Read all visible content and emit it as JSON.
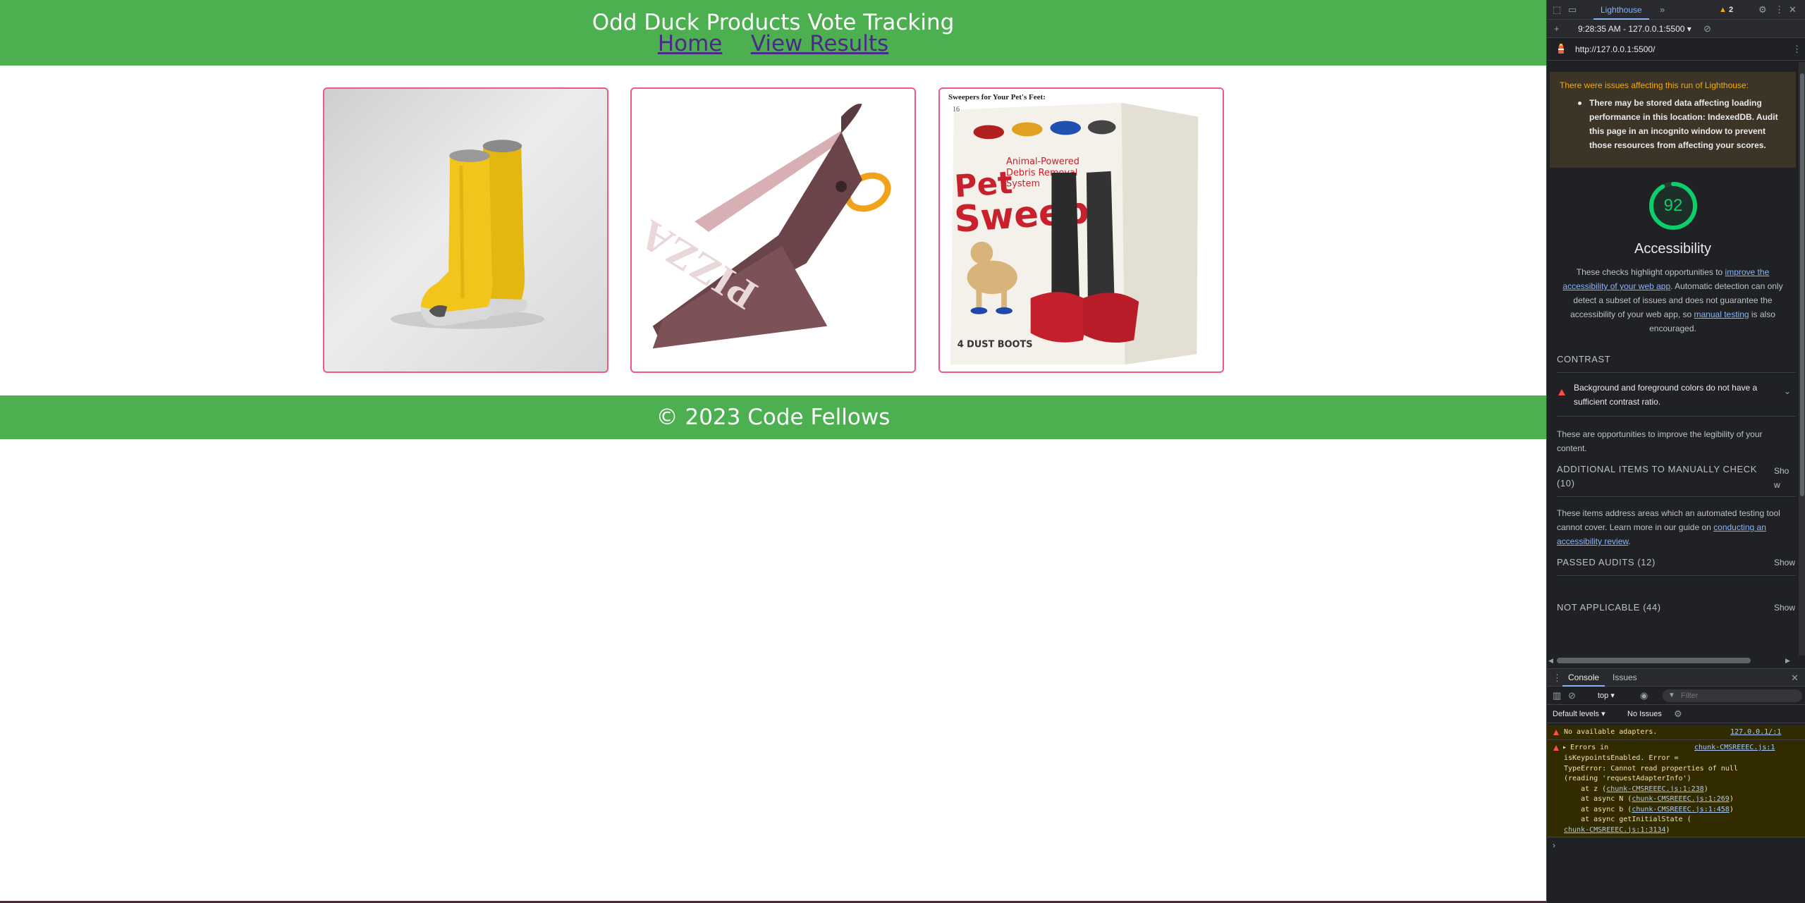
{
  "page": {
    "title": "Odd Duck Products Vote Tracking",
    "nav": {
      "home": "Home",
      "results": "View Results"
    },
    "products": [
      {
        "name": "boots"
      },
      {
        "name": "pizza scissors"
      },
      {
        "name": "pet sweep",
        "caption": "Sweepers for Your Pet's Feet:",
        "number": "16"
      }
    ],
    "footer": "© 2023 Code Fellows",
    "colors": {
      "header": "#4caf50",
      "card_border": "#f05a7e",
      "link": "#4a2a88"
    }
  },
  "devtools": {
    "active_tab": "Lighthouse",
    "warning_count": "2",
    "report_timestamp": "9:28:35 AM - 127.0.0.1:5500",
    "url": "http://127.0.0.1:5500/",
    "run_warning": {
      "title": "There were issues affecting this run of Lighthouse:",
      "item": "There may be stored data affecting loading performance in this location: IndexedDB. Audit this page in an incognito window to prevent those resources from affecting your scores."
    },
    "category": {
      "score": "92",
      "title": "Accessibility",
      "desc_1": "These checks highlight opportunities to ",
      "desc_link_1": "improve the accessibility of your web app",
      "desc_2": ". Automatic detection can only detect a subset of issues and does not guarantee the accessibility of your web app, so ",
      "desc_link_2": "manual testing",
      "desc_3": " is also encouraged."
    },
    "groups": {
      "contrast": "CONTRAST",
      "contrast_audit": "Background and foreground colors do not have a sufficient contrast ratio.",
      "contrast_desc": "These are opportunities to improve the legibility of your content.",
      "manual": "ADDITIONAL ITEMS TO MANUALLY CHECK (10)",
      "manual_show": "Show",
      "manual_desc_1": "These items address areas which an automated testing tool cannot cover. Learn more in our guide on ",
      "manual_desc_link": "conducting an accessibility review",
      "manual_desc_2": ".",
      "passed": "PASSED AUDITS (12)",
      "passed_show": "Show",
      "na": "NOT APPLICABLE (44)",
      "na_show": "Show"
    },
    "drawer": {
      "tabs": [
        "Console",
        "Issues"
      ],
      "context": "top",
      "filter_placeholder": "Filter",
      "levels": "Default levels",
      "issues": "No Issues"
    },
    "console": {
      "msg1": "No available adapters.",
      "msg1_src": "127.0.0.1/:1",
      "msg2_head": "Errors in",
      "msg2_src": "chunk-CMSREEEC.js:1",
      "msg2_l1": "isKeypointsEnabled. Error =",
      "msg2_l2": "TypeError: Cannot read properties of null",
      "msg2_l3": "(reading 'requestAdapterInfo')",
      "msg2_l4_pre": "    at z (",
      "msg2_l4_link": "chunk-CMSREEEC.js:1:238",
      "msg2_l5_pre": "    at async N (",
      "msg2_l5_link": "chunk-CMSREEEC.js:1:269",
      "msg2_l6_pre": "    at async b (",
      "msg2_l6_link": "chunk-CMSREEEC.js:1:458",
      "msg2_l7": "    at async getInitialState (",
      "msg2_l8_link": "chunk-CMSREEEC.js:1:3134",
      "close_paren": ")"
    }
  }
}
